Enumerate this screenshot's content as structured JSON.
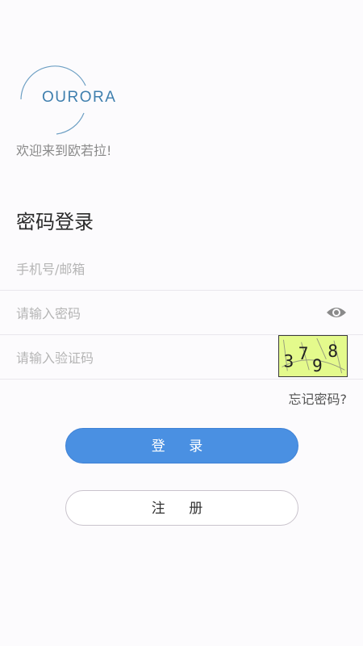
{
  "brand": {
    "logo_text": "OURORA",
    "welcome": "欢迎来到欧若拉!"
  },
  "login": {
    "title": "密码登录",
    "account_placeholder": "手机号/邮箱",
    "password_placeholder": "请输入密码",
    "captcha_placeholder": "请输入验证码",
    "captcha_text": [
      "3",
      "7",
      "9",
      "8"
    ],
    "forgot_password": "忘记密码?",
    "login_button": "登 录",
    "register_button": "注 册"
  },
  "colors": {
    "primary": "#4a90e2",
    "logo": "#3f7fae",
    "captcha_bg": "#e4fa8c"
  },
  "icons": {
    "password_visibility": "eye-icon"
  }
}
